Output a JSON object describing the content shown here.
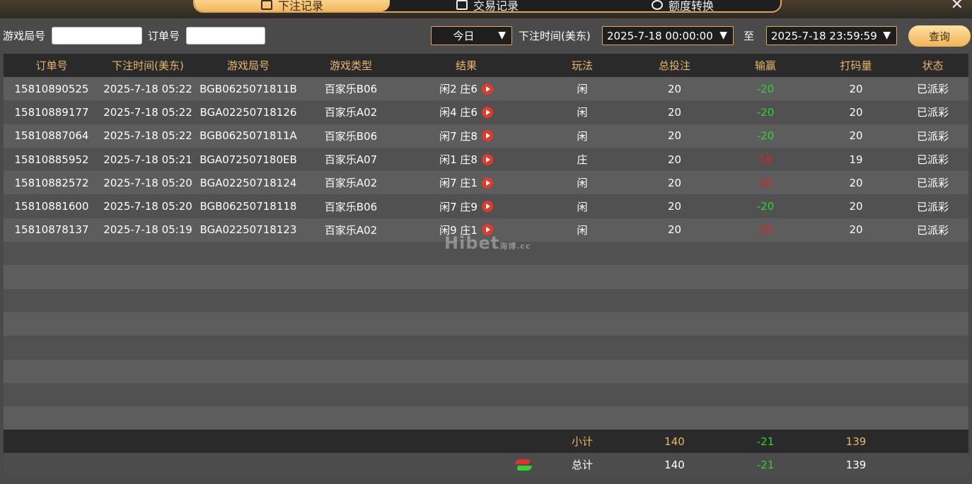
{
  "tabs": [
    {
      "label": "下注记录",
      "active": true
    },
    {
      "label": "交易记录",
      "active": false
    },
    {
      "label": "额度转换",
      "active": false
    }
  ],
  "filters": {
    "game_round_label": "游戏局号",
    "order_label": "订单号",
    "period_value": "今日",
    "time_label": "下注时间(美东)",
    "start_time": "2025-7-18 00:00:00",
    "to_label": "至",
    "end_time": "2025-7-18 23:59:59",
    "query_label": "查询"
  },
  "table": {
    "headers": [
      "订单号",
      "下注时间(美东)",
      "游戏局号",
      "游戏类型",
      "结果",
      "玩法",
      "总投注",
      "输赢",
      "打码量",
      "状态"
    ],
    "rows": [
      {
        "order": "15810890525",
        "time": "2025-7-18 05:22",
        "round": "BGB0625071811B",
        "type": "百家乐B06",
        "result": "闲2 庄6",
        "play": "闲",
        "bet": "20",
        "win": "-20",
        "valid": "20",
        "status": "已派彩"
      },
      {
        "order": "15810889177",
        "time": "2025-7-18 05:22",
        "round": "BGA02250718126",
        "type": "百家乐A02",
        "result": "闲4 庄6",
        "play": "闲",
        "bet": "20",
        "win": "-20",
        "valid": "20",
        "status": "已派彩"
      },
      {
        "order": "15810887064",
        "time": "2025-7-18 05:22",
        "round": "BGB0625071811A",
        "type": "百家乐B06",
        "result": "闲7 庄8",
        "play": "闲",
        "bet": "20",
        "win": "-20",
        "valid": "20",
        "status": "已派彩"
      },
      {
        "order": "15810885952",
        "time": "2025-7-18 05:21",
        "round": "BGA072507180EB",
        "type": "百家乐A07",
        "result": "闲1 庄8",
        "play": "庄",
        "bet": "20",
        "win": "19",
        "valid": "19",
        "status": "已派彩"
      },
      {
        "order": "15810882572",
        "time": "2025-7-18 05:20",
        "round": "BGA02250718124",
        "type": "百家乐A02",
        "result": "闲7 庄1",
        "play": "闲",
        "bet": "20",
        "win": "20",
        "valid": "20",
        "status": "已派彩"
      },
      {
        "order": "15810881600",
        "time": "2025-7-18 05:20",
        "round": "BGB06250718118",
        "type": "百家乐B06",
        "result": "闲7 庄9",
        "play": "闲",
        "bet": "20",
        "win": "-20",
        "valid": "20",
        "status": "已派彩"
      },
      {
        "order": "15810878137",
        "time": "2025-7-18 05:19",
        "round": "BGA02250718123",
        "type": "百家乐A02",
        "result": "闲9 庄1",
        "play": "闲",
        "bet": "20",
        "win": "20",
        "valid": "20",
        "status": "已派彩"
      }
    ],
    "empty_rows": 8
  },
  "subtotal": {
    "label": "小计",
    "bet": "140",
    "win": "-21",
    "valid": "139"
  },
  "total": {
    "label": "总计",
    "bet": "140",
    "win": "-21",
    "valid": "139"
  },
  "watermark": {
    "main": "Hibet",
    "cn": "海博",
    "suffix": ".cc"
  },
  "colors": {
    "accent": "#e8b76a",
    "positive": "#e02020",
    "negative": "#2fd52f"
  }
}
